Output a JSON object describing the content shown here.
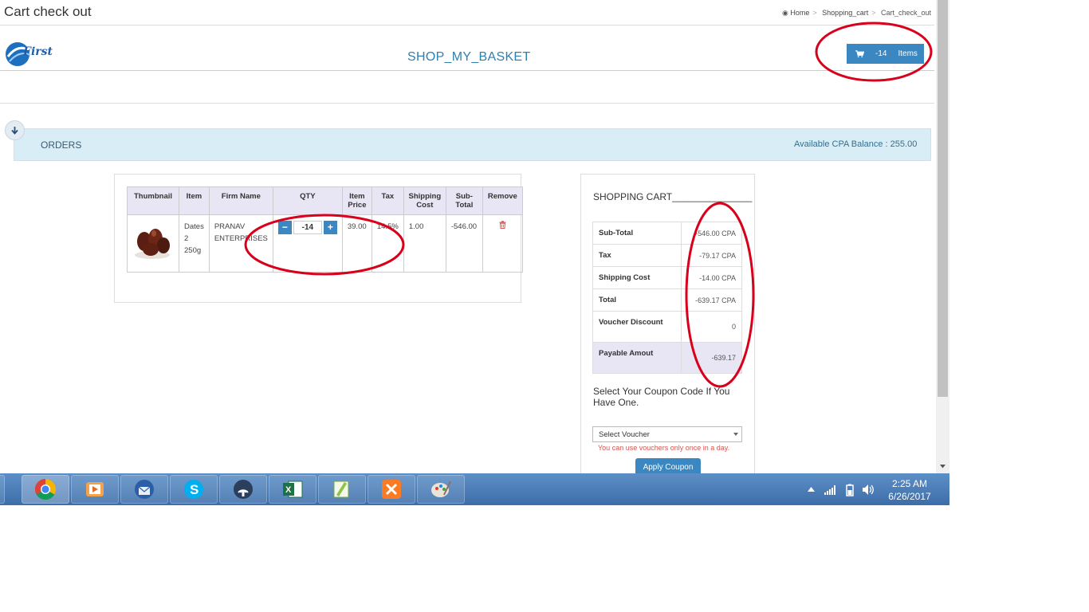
{
  "page": {
    "title": "Cart check out"
  },
  "breadcrumb": {
    "home": "Home",
    "shopping_cart": "Shopping_cart",
    "current": "Cart_check_out"
  },
  "navbar": {
    "site_name": "SHOP_MY_BASKET",
    "cart_count": "-14",
    "cart_label": "Items",
    "logo_text": "First"
  },
  "orders": {
    "title": "ORDERS",
    "balance": "Available CPA Balance : 255.00"
  },
  "cart_table": {
    "headers": [
      "Thumbnail",
      "Item",
      "Firm Name",
      "QTY",
      "Item Price",
      "Tax",
      "Shipping Cost",
      "Sub-Total",
      "Remove"
    ],
    "rows": [
      {
        "item": "Dates 2 250g",
        "firm": "PRANAV ENTERPRISES",
        "qty": "-14",
        "price": "39.00",
        "tax": "14.5%",
        "shipping": "1.00",
        "subtotal": "-546.00"
      }
    ]
  },
  "summary": {
    "title": "SHOPPING CART_______________",
    "rows": [
      {
        "label": "Sub-Total",
        "value": "-546.00 CPA"
      },
      {
        "label": "Tax",
        "value": "-79.17 CPA"
      },
      {
        "label": "Shipping Cost",
        "value": "-14.00 CPA"
      },
      {
        "label": "Total",
        "value": "-639.17 CPA"
      },
      {
        "label": "Voucher Discount",
        "value": "0"
      },
      {
        "label": "Payable Amout",
        "value": "-639.17"
      }
    ]
  },
  "coupon": {
    "prompt": "Select Your Coupon Code If You Have One.",
    "select_value": "Select Voucher",
    "note": "You can use vouchers only once in a day.",
    "apply_label": "Apply Coupon"
  },
  "taskbar": {
    "apps": [
      "file-explorer-icon",
      "chrome-icon",
      "media-player-icon",
      "thunderbird-icon",
      "skype-icon",
      "network-app-icon",
      "excel-icon",
      "notepad-plus-icon",
      "xampp-icon",
      "paint-icon"
    ],
    "time": "2:25 AM",
    "date": "6/26/2017"
  },
  "colors": {
    "accent": "#3a87c2",
    "annotation": "#d9001b",
    "orders_bg": "#d9edf7",
    "table_header_bg": "#e8e6f4"
  }
}
